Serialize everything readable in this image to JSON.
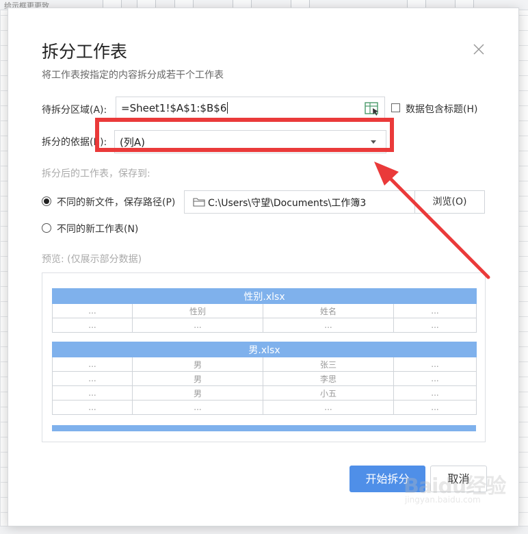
{
  "background": {
    "toolbar_text": "给示框更更致"
  },
  "dialog": {
    "title": "拆分工作表",
    "subtitle": "将工作表按指定的内容拆分成若干个工作表",
    "range_label": "待拆分区域(A):",
    "range_value": "=Sheet1!$A$1:$B$6",
    "header_checkbox_label": "数据包含标题(H)",
    "header_checkbox_checked": false,
    "basis_label": "拆分的依据(B):",
    "basis_value": "(列A)",
    "save_section_label": "拆分后的工作表，保存到:",
    "option_new_file_label": "不同的新文件，保存路径(P)",
    "option_new_file_checked": true,
    "save_path": "C:\\Users\\守望\\Documents\\工作簿3",
    "browse_label": "浏览(O)",
    "option_new_sheet_label": "不同的新工作表(N)",
    "option_new_sheet_checked": false,
    "preview_label": "预览:  (仅展示部分数据)",
    "preview": {
      "table1": {
        "title": "性别.xlsx",
        "rows": [
          [
            "...",
            "性别",
            "姓名",
            "..."
          ],
          [
            "...",
            "...",
            "...",
            "..."
          ]
        ]
      },
      "table2": {
        "title": "男.xlsx",
        "rows": [
          [
            "...",
            "男",
            "张三",
            "..."
          ],
          [
            "...",
            "男",
            "李思",
            "..."
          ],
          [
            "...",
            "男",
            "小五",
            "..."
          ],
          [
            "...",
            "...",
            "...",
            "..."
          ]
        ]
      }
    },
    "start_button": "开始拆分",
    "cancel_button": "取消"
  },
  "annotation": {
    "color": "#ea3a3a"
  },
  "watermark": {
    "main": "Baidu经验",
    "sub": "jingyan.baidu.com"
  }
}
